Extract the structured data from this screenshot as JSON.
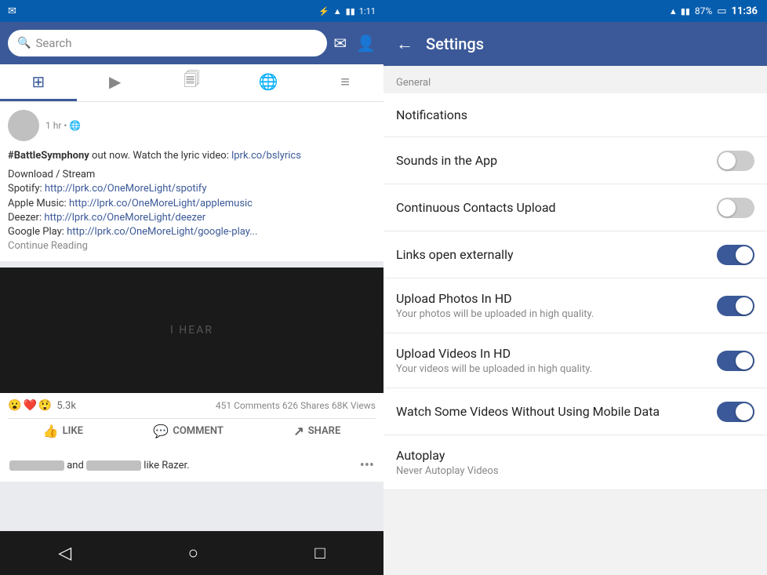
{
  "left": {
    "statusBar": {
      "whatsapp": "✉",
      "bluetooth": "⚡",
      "wifi": "▲",
      "signal": "▮▮▮",
      "time": "1:11"
    },
    "searchPlaceholder": "Search",
    "nav": {
      "tabs": [
        "🏠",
        "▶",
        "🗐",
        "🌐",
        "≡"
      ]
    },
    "post": {
      "time": "1 hr",
      "bodyLine1Start": "#BattleSymphony",
      "bodyLine1End": " out now. Watch the lyric video: ",
      "link1": "lprk.co/bslyrics",
      "downloadStream": "Download / Stream",
      "spotify": "Spotify: ",
      "spotifyLink": "http://lprk.co/OneMoreLight/spotify",
      "appleMusic": "Apple Music: ",
      "appleMusicLink": "http://lprk.co/OneMoreLight/applemusic",
      "deezer": "Deezer: ",
      "deezerLink": "http://lprk.co/OneMoreLight/deezer",
      "googlePlay": "Google Play: ",
      "googlePlayLink": "http://lprk.co/OneMoreLight/google-play...",
      "continueReading": "Continue Reading"
    },
    "video": {
      "text": "I HEAR"
    },
    "reactions": {
      "emojis": [
        "😮",
        "❤️",
        "😲"
      ],
      "count": "5.3k",
      "comments": "451 Comments",
      "shares": "626 Shares",
      "views": "68K Views"
    },
    "actions": {
      "like": "LIKE",
      "comment": "COMMENT",
      "share": "SHARE"
    },
    "notification": {
      "text": "and",
      "suffix": "like Razer."
    },
    "bottomNav": {
      "back": "◁",
      "home": "○",
      "recent": "□"
    }
  },
  "right": {
    "statusBar": {
      "wifi": "▲",
      "signal": "▮▮",
      "battery": "87%",
      "batteryIcon": "🔋",
      "time": "11:36"
    },
    "header": {
      "backIcon": "←",
      "title": "Settings"
    },
    "sectionLabel": "General",
    "items": [
      {
        "id": "notifications",
        "title": "Notifications",
        "subtitle": "",
        "hasToggle": false
      },
      {
        "id": "sounds",
        "title": "Sounds in the App",
        "subtitle": "",
        "hasToggle": true,
        "toggleState": "off"
      },
      {
        "id": "contacts",
        "title": "Continuous Contacts Upload",
        "subtitle": "",
        "hasToggle": true,
        "toggleState": "off"
      },
      {
        "id": "links",
        "title": "Links open externally",
        "subtitle": "",
        "hasToggle": true,
        "toggleState": "on"
      },
      {
        "id": "photos-hd",
        "title": "Upload Photos In HD",
        "subtitle": "Your photos will be uploaded in high quality.",
        "hasToggle": true,
        "toggleState": "on"
      },
      {
        "id": "videos-hd",
        "title": "Upload Videos In HD",
        "subtitle": "Your videos will be uploaded in high quality.",
        "hasToggle": true,
        "toggleState": "on"
      },
      {
        "id": "mobile-data",
        "title": "Watch Some Videos Without Using Mobile Data",
        "subtitle": "",
        "hasToggle": true,
        "toggleState": "on"
      },
      {
        "id": "autoplay",
        "title": "Autoplay",
        "subtitle": "Never Autoplay Videos",
        "hasToggle": false
      }
    ]
  }
}
